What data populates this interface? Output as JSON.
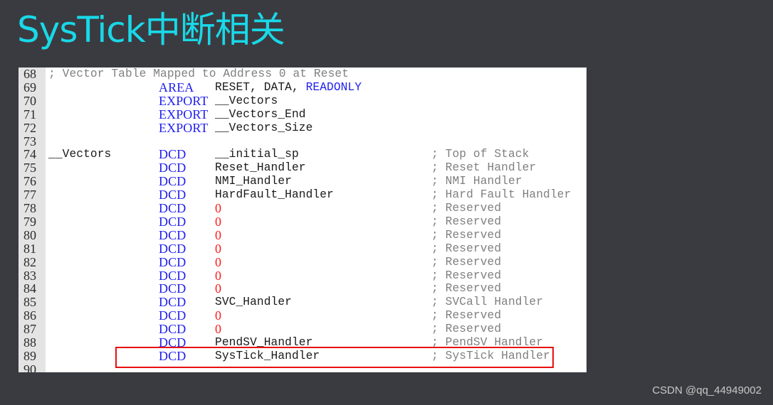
{
  "slide": {
    "title": "SysTick中断相关",
    "watermark": "CSDN @qq_44949002",
    "colors": {
      "background": "#3a3b40",
      "title": "#19d8e8",
      "keyword": "#1e1ef0",
      "number": "#ff1a1a",
      "comment": "#808080",
      "highlight_border": "#e81010"
    }
  },
  "code": {
    "lines": [
      {
        "n": "68",
        "comment_full": "; Vector Table Mapped to Address 0 at Reset"
      },
      {
        "n": "69",
        "kw": "AREA",
        "arg": "RESET, DATA, ",
        "arg_kw": "READONLY"
      },
      {
        "n": "70",
        "kw": "EXPORT",
        "arg": "__Vectors"
      },
      {
        "n": "71",
        "kw": "EXPORT",
        "arg": "__Vectors_End"
      },
      {
        "n": "72",
        "kw": "EXPORT",
        "arg": "__Vectors_Size"
      },
      {
        "n": "73"
      },
      {
        "n": "74",
        "label": "__Vectors",
        "kw": "DCD",
        "arg": "__initial_sp",
        "comment": "; Top of Stack"
      },
      {
        "n": "75",
        "kw": "DCD",
        "arg": "Reset_Handler",
        "comment": "; Reset Handler"
      },
      {
        "n": "76",
        "kw": "DCD",
        "arg": "NMI_Handler",
        "comment": "; NMI Handler"
      },
      {
        "n": "77",
        "kw": "DCD",
        "arg": "HardFault_Handler",
        "comment": "; Hard Fault Handler"
      },
      {
        "n": "78",
        "kw": "DCD",
        "num": "0",
        "comment": "; Reserved"
      },
      {
        "n": "79",
        "kw": "DCD",
        "num": "0",
        "comment": "; Reserved"
      },
      {
        "n": "80",
        "kw": "DCD",
        "num": "0",
        "comment": "; Reserved"
      },
      {
        "n": "81",
        "kw": "DCD",
        "num": "0",
        "comment": "; Reserved"
      },
      {
        "n": "82",
        "kw": "DCD",
        "num": "0",
        "comment": "; Reserved"
      },
      {
        "n": "83",
        "kw": "DCD",
        "num": "0",
        "comment": "; Reserved"
      },
      {
        "n": "84",
        "kw": "DCD",
        "num": "0",
        "comment": "; Reserved"
      },
      {
        "n": "85",
        "kw": "DCD",
        "arg": "SVC_Handler",
        "comment": "; SVCall Handler"
      },
      {
        "n": "86",
        "kw": "DCD",
        "num": "0",
        "comment": "; Reserved"
      },
      {
        "n": "87",
        "kw": "DCD",
        "num": "0",
        "comment": "; Reserved"
      },
      {
        "n": "88",
        "kw": "DCD",
        "arg": "PendSV_Handler",
        "comment": "; PendSV Handler"
      },
      {
        "n": "89",
        "kw": "DCD",
        "arg": "SysTick_Handler",
        "comment": "; SysTick Handler",
        "highlighted": true
      },
      {
        "n": "90"
      }
    ]
  }
}
